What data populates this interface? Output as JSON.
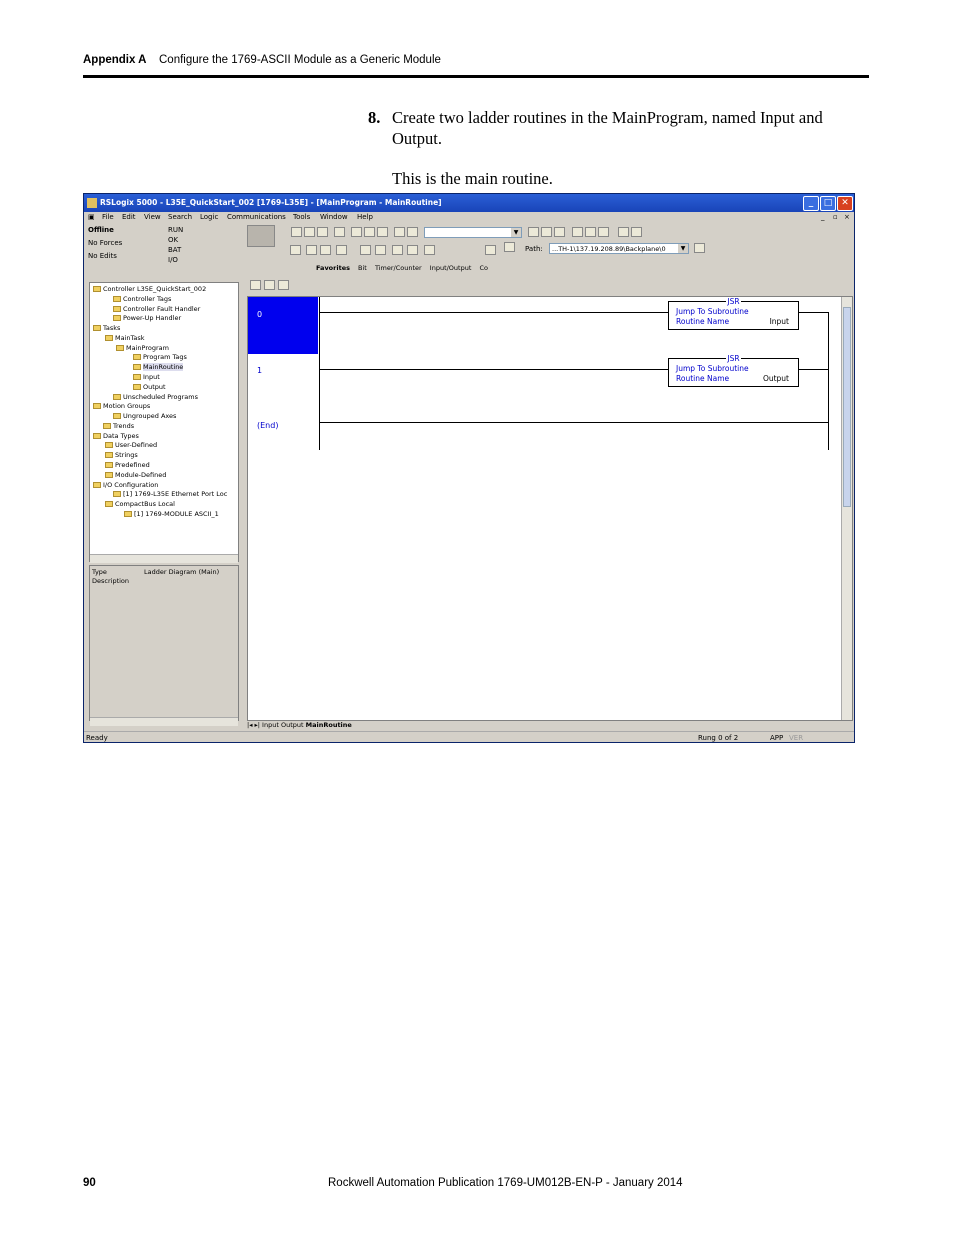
{
  "header": {
    "appendix": "Appendix A",
    "title": "Configure the 1769-ASCII Module as a Generic Module"
  },
  "step": {
    "number": "8.",
    "text": "Create two ladder routines in the MainProgram, named Input and Output.",
    "note": "This is the main routine."
  },
  "window": {
    "title": "RSLogix 5000 - L35E_QuickStart_002 [1769-L35E] - [MainProgram - MainRoutine]",
    "menu": [
      "File",
      "Edit",
      "View",
      "Search",
      "Logic",
      "Communications",
      "Tools",
      "Window",
      "Help"
    ],
    "status": {
      "mode": "Offline",
      "forces": "No Forces",
      "edits": "No Edits"
    },
    "indicators": [
      "RUN",
      "OK",
      "BAT",
      "I/O"
    ],
    "path_label": "Path:",
    "path_value": "...TH-1\\137.19.208.89\\Backplane\\0",
    "instruction_tabs": [
      "Favorites",
      "Bit",
      "Timer/Counter",
      "Input/Output",
      "Co"
    ],
    "tree": [
      "Controller L35E_QuickStart_002",
      "Controller Tags",
      "Controller Fault Handler",
      "Power-Up Handler",
      "Tasks",
      "MainTask",
      "MainProgram",
      "Program Tags",
      "MainRoutine",
      "Input",
      "Output",
      "Unscheduled Programs",
      "Motion Groups",
      "Ungrouped Axes",
      "Trends",
      "Data Types",
      "User-Defined",
      "Strings",
      "Predefined",
      "Module-Defined",
      "I/O Configuration",
      "[1] 1769-L35E Ethernet Port Loc",
      "CompactBus Local",
      "[1] 1769-MODULE ASCII_1"
    ],
    "props": {
      "type_label": "Type",
      "type_value": "Ladder Diagram (Main)",
      "desc_label": "Description"
    },
    "rungs": [
      {
        "num": "0",
        "header": "JSR",
        "line1": "Jump To Subroutine",
        "line2": "Routine Name",
        "value": "Input"
      },
      {
        "num": "1",
        "header": "JSR",
        "line1": "Jump To Subroutine",
        "line2": "Routine Name",
        "value": "Output"
      }
    ],
    "end_label": "(End)",
    "routine_tabs": [
      "Input",
      "Output",
      "MainRoutine"
    ],
    "statusbar": {
      "left": "Ready",
      "rung": "Rung 0 of 2",
      "app": "APP",
      "ver": "VER"
    }
  },
  "footer": {
    "page": "90",
    "publication": "Rockwell Automation Publication 1769-UM012B-EN-P - January 2014"
  }
}
